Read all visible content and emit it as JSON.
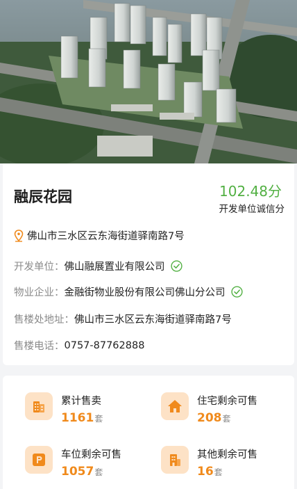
{
  "project": {
    "name": "融辰花园",
    "score_value": "102.48分",
    "score_label": "开发单位诚信分",
    "address": "佛山市三水区云东海街道驿南路7号"
  },
  "details": [
    {
      "label": "开发单位：",
      "value": "佛山融展置业有限公司",
      "verified": true
    },
    {
      "label": "物业企业：",
      "value": "金融街物业股份有限公司佛山分公司",
      "verified": true
    },
    {
      "label": "售楼处地址：",
      "value": "佛山市三水区云东海街道驿南路7号",
      "verified": false
    },
    {
      "label": "售楼电话：",
      "value": "0757-87762888",
      "verified": false
    }
  ],
  "stats": [
    {
      "label": "累计售卖",
      "value": "1161",
      "unit": "套",
      "icon": "building-icon"
    },
    {
      "label": "住宅剩余可售",
      "value": "208",
      "unit": "套",
      "icon": "house-icon"
    },
    {
      "label": "车位剩余可售",
      "value": "1057",
      "unit": "套",
      "icon": "parking-icon"
    },
    {
      "label": "其他剩余可售",
      "value": "16",
      "unit": "套",
      "icon": "shop-icon"
    }
  ],
  "colors": {
    "accent_orange": "#f08a1c",
    "score_green": "#52b043",
    "icon_bg": "#fde2c6",
    "check_green": "#52b043"
  }
}
